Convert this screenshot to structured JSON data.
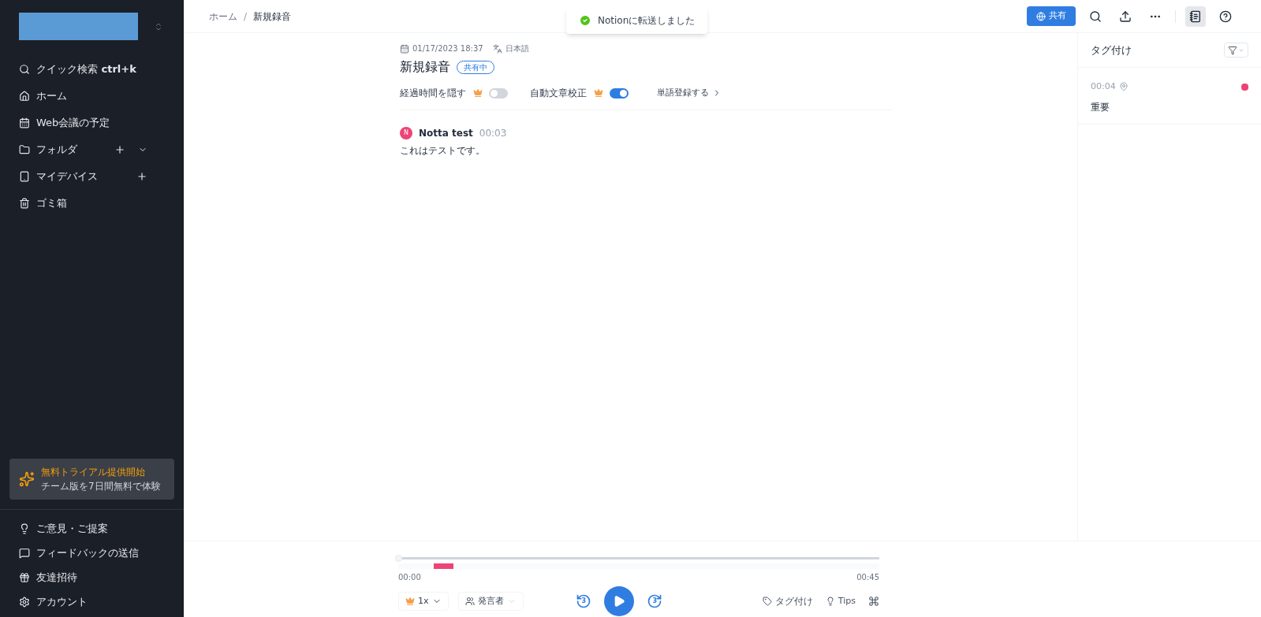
{
  "sidebar": {
    "items": [
      {
        "kind": "search",
        "label": "クイック検索",
        "shortcut": "ctrl+k",
        "add_button": false,
        "expand_button": false
      },
      {
        "kind": "home",
        "label": "ホーム",
        "add_button": false,
        "expand_button": false
      },
      {
        "kind": "calendar",
        "label": "Web会議の予定",
        "add_button": false,
        "expand_button": false
      },
      {
        "kind": "folder",
        "label": "フォルダ",
        "add_button": true,
        "expand_button": true
      },
      {
        "kind": "device",
        "label": "マイデバイス",
        "add_button": true,
        "expand_button": false
      },
      {
        "kind": "trash",
        "label": "ゴミ箱",
        "add_button": false,
        "expand_button": false
      }
    ],
    "promo": {
      "title": "無料トライアル提供開始",
      "subtitle": "チーム版を7日間無料で体験"
    },
    "footer_items": [
      {
        "kind": "bulb",
        "label": "ご意見・ご提案"
      },
      {
        "kind": "feedback",
        "label": "フィードバックの送信"
      },
      {
        "kind": "gift",
        "label": "友達招待"
      },
      {
        "kind": "account",
        "label": "アカウント"
      }
    ]
  },
  "header": {
    "breadcrumbs": [
      "ホーム",
      "新規録音"
    ],
    "breadcrumb_separator": "/",
    "toast": "Notionに転送しました",
    "share_button": "共有",
    "toolbar": [
      {
        "kind": "search",
        "selected": false
      },
      {
        "kind": "export",
        "selected": false
      },
      {
        "kind": "more",
        "selected": false
      },
      {
        "kind": "notes",
        "selected": true
      },
      {
        "kind": "help",
        "selected": false
      }
    ]
  },
  "recording": {
    "date": "01/17/2023 18:37",
    "language": "日本語",
    "title": "新規録音",
    "badge": "共有中",
    "options": [
      {
        "label": "経過時間を隠す",
        "premium": true,
        "on": false
      },
      {
        "label": "自動文章校正",
        "premium": true,
        "on": true
      }
    ],
    "link": "単語登録する"
  },
  "transcript": [
    {
      "initial": "N",
      "speaker": "Notta test",
      "time": "00:03",
      "text": "これはテストです。"
    }
  ],
  "tags_panel": {
    "title": "タグ付け",
    "items": [
      {
        "time": "00:04",
        "label": "重要",
        "color": "#ec4477"
      }
    ]
  },
  "player": {
    "start": "00:00",
    "end": "00:45",
    "level": 0,
    "speed": "1x",
    "speaker": "発言者",
    "skip_back": "3",
    "skip_forward": "3",
    "tag_button": "タグ付け",
    "tips_button": "Tips"
  }
}
